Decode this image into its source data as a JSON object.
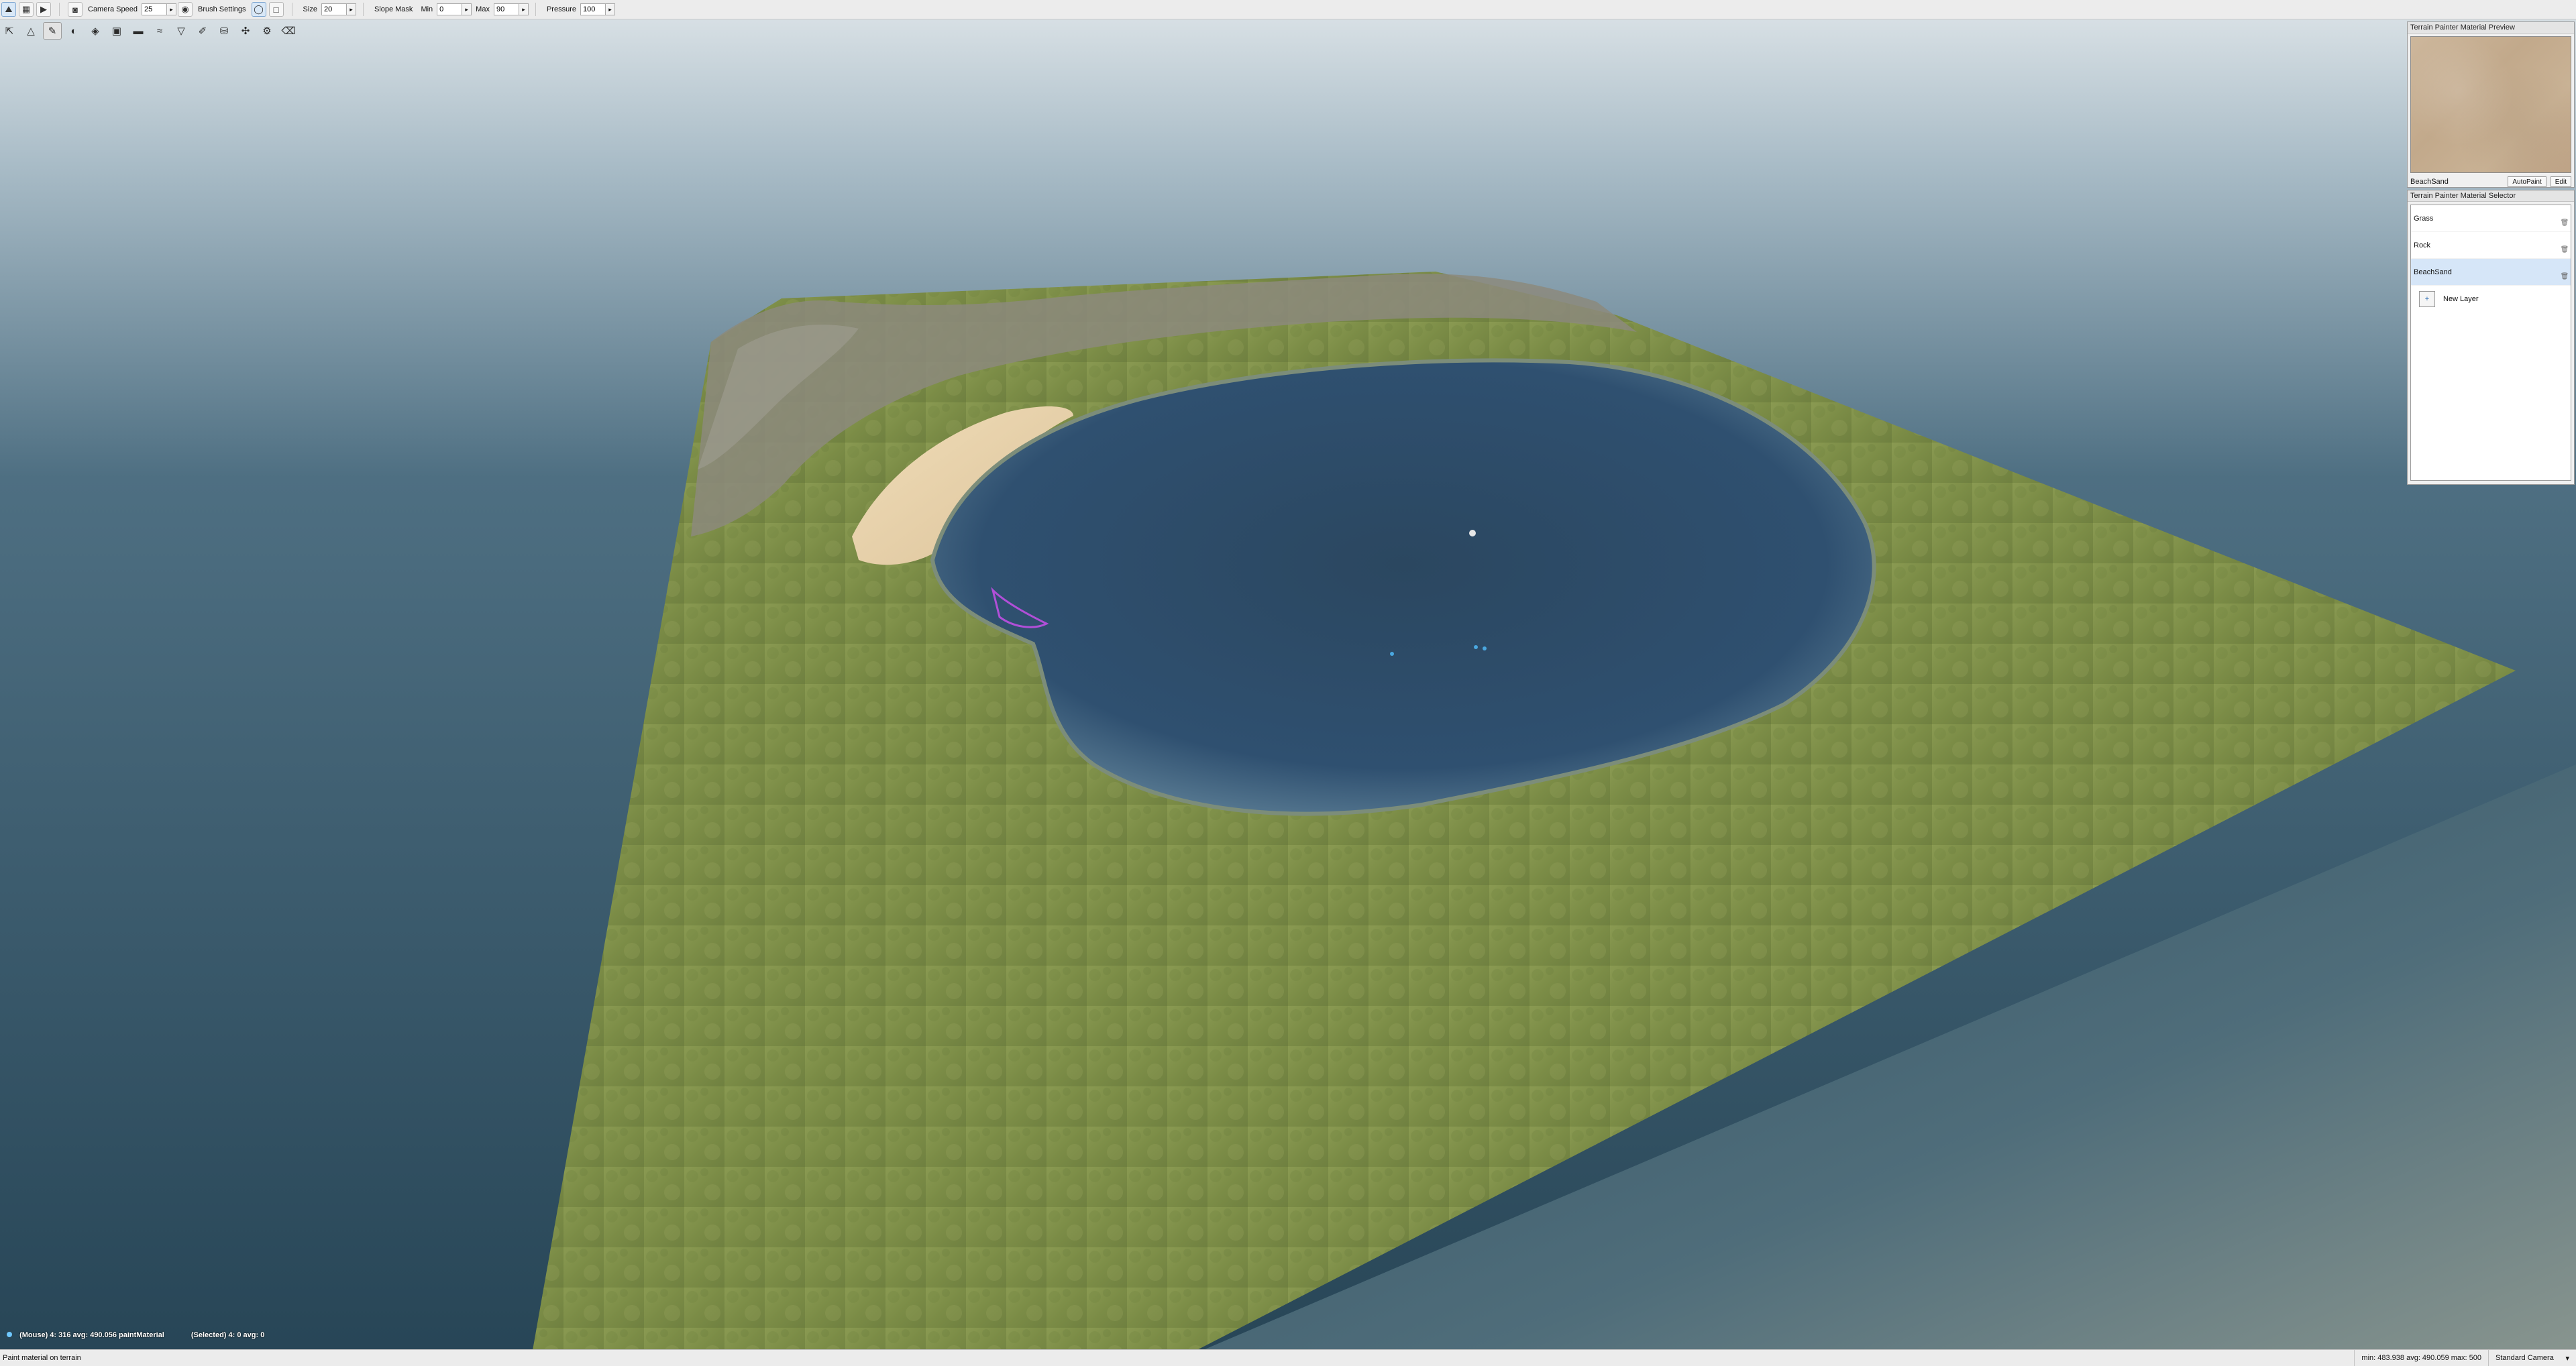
{
  "toolbar": {
    "camera_speed_label": "Camera Speed",
    "camera_speed_value": "25",
    "brush_settings_label": "Brush Settings",
    "size_label": "Size",
    "size_value": "20",
    "slope_mask_label": "Slope Mask",
    "min_label": "Min",
    "min_value": "0",
    "max_label": "Max",
    "max_value": "90",
    "pressure_label": "Pressure",
    "pressure_value": "100"
  },
  "tools": [
    {
      "icon": "select-arrow-icon"
    },
    {
      "icon": "raise-height-icon"
    },
    {
      "icon": "paint-material-icon"
    },
    {
      "icon": "sphere-icon"
    },
    {
      "icon": "layers-icon"
    },
    {
      "icon": "save-icon"
    },
    {
      "icon": "flatten-icon"
    },
    {
      "icon": "smooth-icon"
    },
    {
      "icon": "lower-height-icon"
    },
    {
      "icon": "brush-icon"
    },
    {
      "icon": "bucket-icon"
    },
    {
      "icon": "noise-icon"
    },
    {
      "icon": "adjust-icon"
    },
    {
      "icon": "clear-icon"
    }
  ],
  "preview_panel": {
    "title": "Terrain Painter Material Preview",
    "material_name": "BeachSand",
    "autopaint_label": "AutoPaint",
    "edit_label": "Edit"
  },
  "selector_panel": {
    "title": "Terrain Painter Material Selector",
    "items": [
      {
        "label": "Grass",
        "selected": false
      },
      {
        "label": "Rock",
        "selected": false
      },
      {
        "label": "BeachSand",
        "selected": true
      }
    ],
    "new_layer_label": "New Layer"
  },
  "hud": {
    "mouse_text": "(Mouse) 4: 316  avg: 490.056 paintMaterial",
    "selected_text": "(Selected) 4: 0  avg: 0"
  },
  "status": {
    "left_text": "Paint material on terrain",
    "stats_text": "min: 483.938  avg: 490.059  max: 500",
    "camera_label": "Standard Camera"
  },
  "colors": {
    "grass": "#7c8f48",
    "water": "#2d4e6a",
    "sand": "#e8d2ac",
    "sky_top": "#dfe6ea",
    "sky_bottom": "#2d5368"
  }
}
